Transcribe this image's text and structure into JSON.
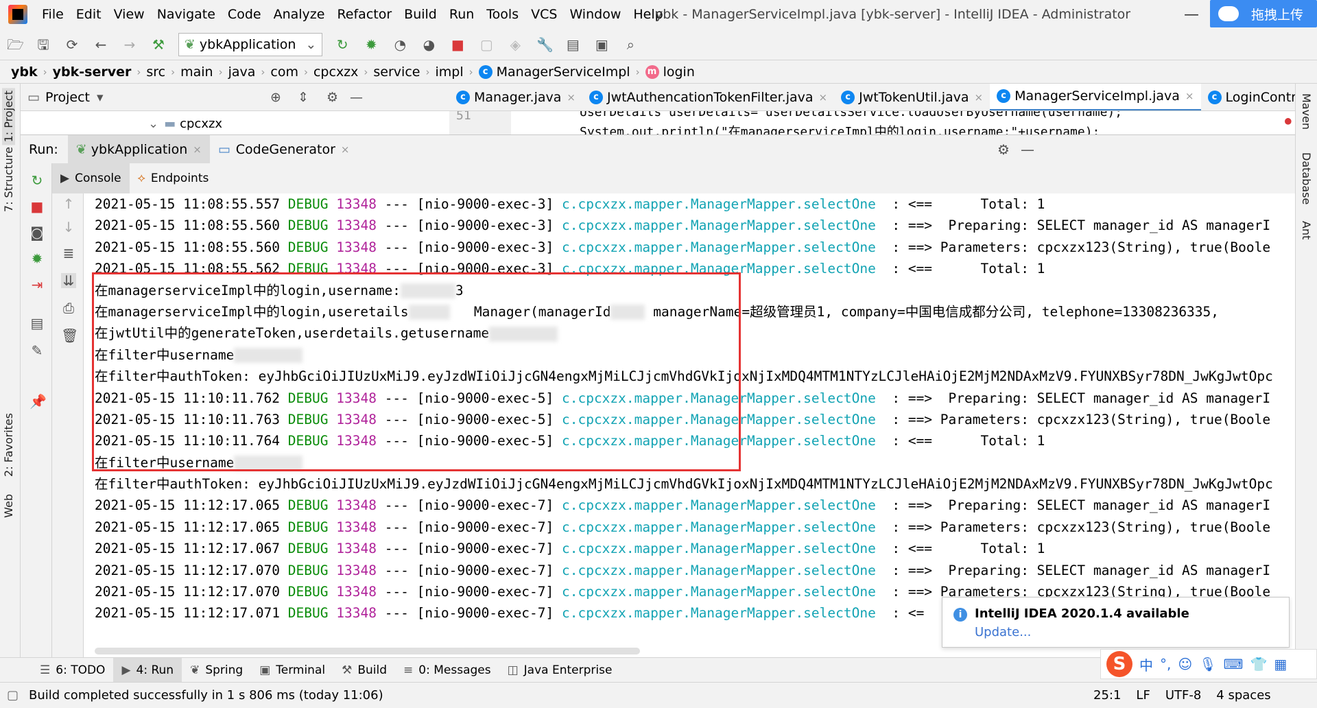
{
  "menubar": {
    "items": [
      "File",
      "Edit",
      "View",
      "Navigate",
      "Code",
      "Analyze",
      "Refactor",
      "Build",
      "Run",
      "Tools",
      "VCS",
      "Window",
      "Help"
    ],
    "window_title": "ybk - ManagerServiceImpl.java [ybk-server] - IntelliJ IDEA - Administrator",
    "upload_label": "拖拽上传"
  },
  "toolbar": {
    "run_config": "ybkApplication"
  },
  "breadcrumb": {
    "items": [
      "ybk",
      "ybk-server",
      "src",
      "main",
      "java",
      "com",
      "cpcxzx",
      "service",
      "impl",
      "ManagerServiceImpl",
      "login"
    ]
  },
  "side_tabs": {
    "project": "1: Project",
    "structure": "7: Structure",
    "favorites": "2: Favorites",
    "web": "Web",
    "maven": "Maven",
    "database": "Database",
    "ant": "Ant"
  },
  "project_panel": {
    "title": "Project",
    "tree_item": "cpcxzx"
  },
  "editor": {
    "tabs": [
      "Manager.java",
      "JwtAuthencationTokenFilter.java",
      "JwtTokenUtil.java",
      "ManagerServiceImpl.java",
      "LoginContro"
    ],
    "active_tab": 3,
    "line_number": "51",
    "code_line": "UserDetails userDetails= userDetailsService.loadUserByUsername(username);",
    "code_line2": "System.out.println(\"在managerserviceImpl中的login,username:\"+username);"
  },
  "run_panel": {
    "label": "Run:",
    "tabs": [
      "ybkApplication",
      "CodeGenerator"
    ],
    "console_tabs": [
      "Console",
      "Endpoints"
    ]
  },
  "console": {
    "mapper": "c.cpcxzx.mapper.ManagerMapper.selectOne",
    "lines": [
      {
        "type": "log",
        "ts": "2021-05-15 11:08:55.557",
        "level": "DEBUG",
        "pid": "13348",
        "thread": "--- [nio-9000-exec-3]",
        "arrow": ": <==",
        "msg": "     Total: 1"
      },
      {
        "type": "log",
        "ts": "2021-05-15 11:08:55.560",
        "level": "DEBUG",
        "pid": "13348",
        "thread": "--- [nio-9000-exec-3]",
        "arrow": ": ==>",
        "msg": " Preparing: SELECT manager_id AS managerI"
      },
      {
        "type": "log",
        "ts": "2021-05-15 11:08:55.560",
        "level": "DEBUG",
        "pid": "13348",
        "thread": "--- [nio-9000-exec-3]",
        "arrow": ": ==>",
        "msg": "Parameters: cpcxzx123(String), true(Boole"
      },
      {
        "type": "log",
        "ts": "2021-05-15 11:08:55.562",
        "level": "DEBUG",
        "pid": "13348",
        "thread": "--- [nio-9000-exec-3]",
        "arrow": ": <==",
        "msg": "     Total: 1"
      },
      {
        "type": "text",
        "text": "在managerserviceImpl中的login,username:",
        "blur_w": 80,
        "tail": "3"
      },
      {
        "type": "text",
        "text": "在managerserviceImpl中的login,useretails",
        "blur_w": 60,
        "tail": "   Manager(managerId",
        "tail2": "managerName=超级管理员1, company=中国电信成都分公司, telephone=13308236335,"
      },
      {
        "type": "text",
        "text": "在jwtUtil中的generateToken,userdetails.getusername",
        "blur_w": 100,
        "tail": ""
      },
      {
        "type": "text",
        "text": "在filter中username",
        "blur_w": 100,
        "tail": ""
      },
      {
        "type": "text",
        "text": "在filter中authToken: eyJhbGciOiJIUzUxMiJ9.eyJzdWIiOiJjcGN4engxMjMiLCJjcmVhdGVkIjoxNjIxMDQ4MTM1NTYzLCJleHAiOjE2MjM2NDAxMzV9.FYUNXBSyr78DN_JwKgJwtOpc",
        "blur_w": 0,
        "tail": ""
      },
      {
        "type": "log",
        "ts": "2021-05-15 11:10:11.762",
        "level": "DEBUG",
        "pid": "13348",
        "thread": "--- [nio-9000-exec-5]",
        "arrow": ": ==>",
        "msg": " Preparing: SELECT manager_id AS managerI"
      },
      {
        "type": "log",
        "ts": "2021-05-15 11:10:11.763",
        "level": "DEBUG",
        "pid": "13348",
        "thread": "--- [nio-9000-exec-5]",
        "arrow": ": ==>",
        "msg": "Parameters: cpcxzx123(String), true(Boole"
      },
      {
        "type": "log",
        "ts": "2021-05-15 11:10:11.764",
        "level": "DEBUG",
        "pid": "13348",
        "thread": "--- [nio-9000-exec-5]",
        "arrow": ": <==",
        "msg": "     Total: 1"
      },
      {
        "type": "text",
        "text": "在filter中username",
        "blur_w": 100,
        "tail": ""
      },
      {
        "type": "text",
        "text": "在filter中authToken: eyJhbGciOiJIUzUxMiJ9.eyJzdWIiOiJjcGN4engxMjMiLCJjcmVhdGVkIjoxNjIxMDQ4MTM1NTYzLCJleHAiOjE2MjM2NDAxMzV9.FYUNXBSyr78DN_JwKgJwtOpc",
        "blur_w": 0,
        "tail": ""
      },
      {
        "type": "log",
        "ts": "2021-05-15 11:12:17.065",
        "level": "DEBUG",
        "pid": "13348",
        "thread": "--- [nio-9000-exec-7]",
        "arrow": ": ==>",
        "msg": " Preparing: SELECT manager_id AS managerI"
      },
      {
        "type": "log",
        "ts": "2021-05-15 11:12:17.065",
        "level": "DEBUG",
        "pid": "13348",
        "thread": "--- [nio-9000-exec-7]",
        "arrow": ": ==>",
        "msg": "Parameters: cpcxzx123(String), true(Boole"
      },
      {
        "type": "log",
        "ts": "2021-05-15 11:12:17.067",
        "level": "DEBUG",
        "pid": "13348",
        "thread": "--- [nio-9000-exec-7]",
        "arrow": ": <==",
        "msg": "     Total: 1"
      },
      {
        "type": "log",
        "ts": "2021-05-15 11:12:17.070",
        "level": "DEBUG",
        "pid": "13348",
        "thread": "--- [nio-9000-exec-7]",
        "arrow": ": ==>",
        "msg": " Preparing: SELECT manager_id AS managerI"
      },
      {
        "type": "log",
        "ts": "2021-05-15 11:12:17.070",
        "level": "DEBUG",
        "pid": "13348",
        "thread": "--- [nio-9000-exec-7]",
        "arrow": ": ==>",
        "msg": "Parameters: cpcxzx123(String), true(Boole"
      },
      {
        "type": "log",
        "ts": "2021-05-15 11:12:17.071",
        "level": "DEBUG",
        "pid": "13348",
        "thread": "--- [nio-9000-exec-7]",
        "arrow": ": <=",
        "msg": ""
      }
    ]
  },
  "notification": {
    "title": "IntelliJ IDEA 2020.1.4 available",
    "link": "Update..."
  },
  "bottom_tabs": [
    {
      "icon": "todo-icon",
      "glyph": "☰",
      "label": "6: TODO"
    },
    {
      "icon": "run-icon",
      "glyph": "▶",
      "label": "4: Run"
    },
    {
      "icon": "spring-icon",
      "glyph": "❦",
      "label": "Spring"
    },
    {
      "icon": "terminal-icon",
      "glyph": "▣",
      "label": "Terminal"
    },
    {
      "icon": "build-icon",
      "glyph": "⚒",
      "label": "Build"
    },
    {
      "icon": "messages-icon",
      "glyph": "≡",
      "label": "0: Messages"
    },
    {
      "icon": "java-enterprise-icon",
      "glyph": "◫",
      "label": "Java Enterprise"
    }
  ],
  "ime": {
    "logo": "S",
    "lang": "中"
  },
  "statusbar": {
    "message": "Build completed successfully in 1 s 806 ms (today 11:06)",
    "position": "25:1",
    "line_sep": "LF",
    "encoding": "UTF-8",
    "indent": "4 spaces"
  },
  "colors": {
    "highlight_box": "#e53333",
    "debug": "#0a8c0a",
    "pid": "#b0239a",
    "mapper": "#14a4b4",
    "link": "#3a73d1"
  }
}
